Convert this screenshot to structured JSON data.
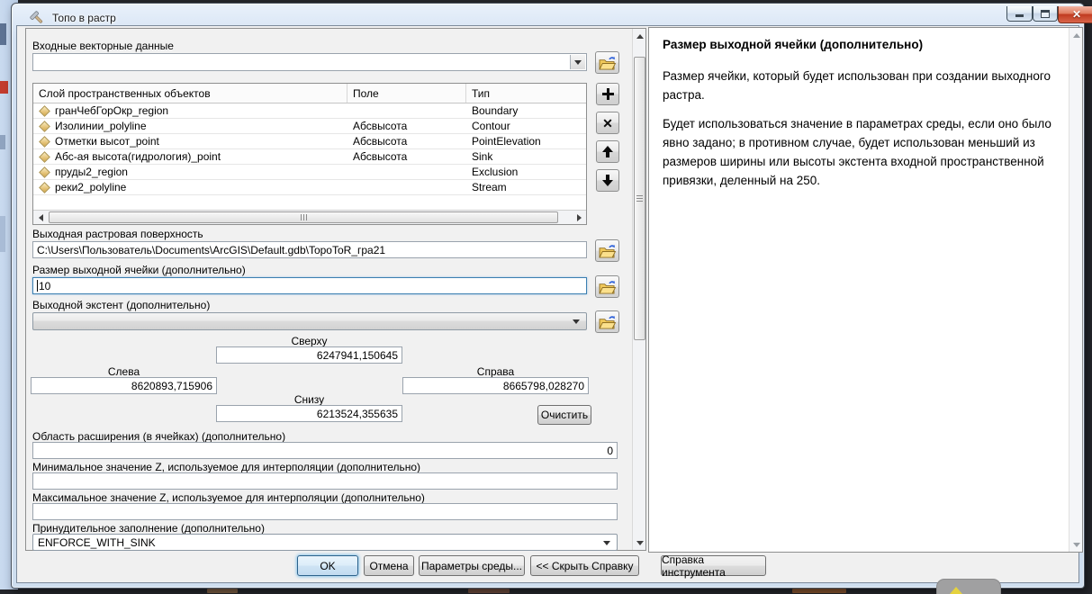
{
  "window": {
    "title": "Топо в растр"
  },
  "left_panel": {
    "input_label": "Входные векторные данные",
    "input_value": "",
    "table": {
      "columns": [
        "Слой пространственных объектов",
        "Поле",
        "Тип"
      ],
      "rows": [
        {
          "layer": "гранЧебГорОкр_region",
          "field": "",
          "type": "Boundary"
        },
        {
          "layer": "Изолинии_polyline",
          "field": "Абсвысота",
          "type": "Contour"
        },
        {
          "layer": "Отметки высот_point",
          "field": "Абсвысота",
          "type": "PointElevation"
        },
        {
          "layer": "Абс-ая высота(гидрология)_point",
          "field": "Абсвысота",
          "type": "Sink"
        },
        {
          "layer": "пруды2_region",
          "field": "",
          "type": "Exclusion"
        },
        {
          "layer": "реки2_polyline",
          "field": "",
          "type": "Stream"
        }
      ]
    },
    "output_surface_label": "Выходная растровая поверхность",
    "output_surface_value": "C:\\Users\\Пользователь\\Documents\\ArcGIS\\Default.gdb\\TopoToR_гра21",
    "cell_size_label": "Размер выходной ячейки (дополнительно)",
    "cell_size_value": "10",
    "extent_label": "Выходной экстент (дополнительно)",
    "extent_value": "",
    "extent": {
      "top_label": "Сверху",
      "top_value": "6247941,150645",
      "left_label": "Слева",
      "left_value": "8620893,715906",
      "right_label": "Справа",
      "right_value": "8665798,028270",
      "bottom_label": "Снизу",
      "bottom_value": "6213524,355635",
      "clear_button": "Очистить"
    },
    "margin_label": "Область расширения (в ячейках) (дополнительно)",
    "margin_value": "0",
    "min_z_label": "Минимальное значение Z, используемое для интерполяции (дополнительно)",
    "min_z_value": "",
    "max_z_label": "Максимальное значение Z, используемое для интерполяции (дополнительно)",
    "max_z_value": "",
    "enforce_label": "Принудительное заполнение (дополнительно)",
    "enforce_value": "ENFORCE_WITH_SINK"
  },
  "action_bar": {
    "ok": "OK",
    "cancel": "Отмена",
    "environments": "Параметры среды...",
    "hide_help": "<< Скрыть Справку",
    "tool_help": "Справка инструмента"
  },
  "help_panel": {
    "title": "Размер выходной ячейки (дополнительно)",
    "p1": "Размер ячейки, который будет использован при создании выходного растра.",
    "p2": "Будет использоваться значение в параметрах среды, если оно было явно задано; в противном случае, будет использован меньший из размеров ширины или высоты экстента входной пространственной привязки, деленный на 250."
  },
  "colors": {
    "accent_focus": "#3c7fb1",
    "close_button": "#c03a20",
    "diamond_icon": "#e4c277"
  }
}
